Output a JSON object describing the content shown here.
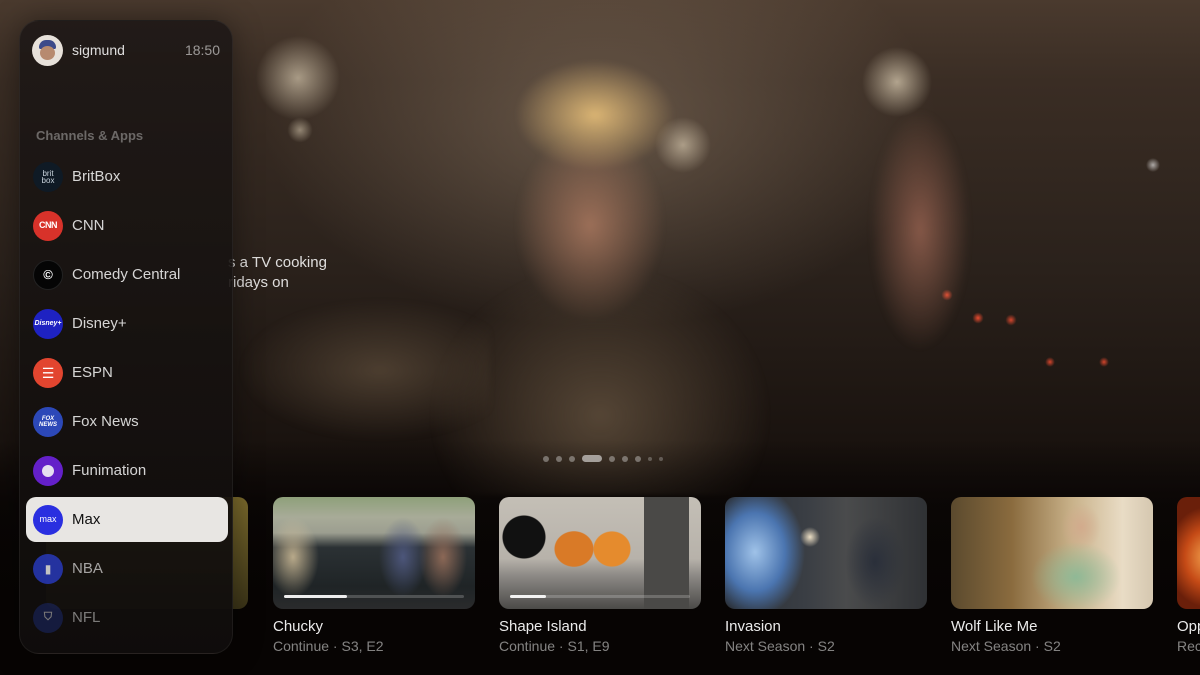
{
  "user": {
    "name": "sigmund",
    "time": "18:50"
  },
  "sidebar": {
    "section_label": "Channels & Apps",
    "items": [
      {
        "label": "BritBox",
        "icon": "britbox-logo-icon",
        "glyph": "brit box",
        "selected": false
      },
      {
        "label": "CNN",
        "icon": "cnn-logo-icon",
        "glyph": "CNN",
        "selected": false
      },
      {
        "label": "Comedy Central",
        "icon": "comedy-central-logo-icon",
        "glyph": "©",
        "selected": false
      },
      {
        "label": "Disney+",
        "icon": "disney-plus-logo-icon",
        "glyph": "Disney+",
        "selected": false
      },
      {
        "label": "ESPN",
        "icon": "espn-logo-icon",
        "glyph": "☰",
        "selected": false
      },
      {
        "label": "Fox News",
        "icon": "fox-news-logo-icon",
        "glyph": "FOX NEWS",
        "selected": false
      },
      {
        "label": "Funimation",
        "icon": "funimation-logo-icon",
        "glyph": "",
        "selected": false
      },
      {
        "label": "Max",
        "icon": "max-logo-icon",
        "glyph": "max",
        "selected": true
      },
      {
        "label": "NBA",
        "icon": "nba-logo-icon",
        "glyph": "▮",
        "selected": false
      },
      {
        "label": "NFL",
        "icon": "nfl-logo-icon",
        "glyph": "⛉",
        "selected": false
      }
    ]
  },
  "hero": {
    "description_lines": [
      "s a TV cooking",
      "ridays on"
    ],
    "page_count": 9,
    "active_page_index": 3
  },
  "up_next": [
    {
      "title": "Chucky",
      "subtitle": "Continue · S3, E2",
      "progress": 0.35
    },
    {
      "title": "Shape Island",
      "subtitle": "Continue · S1, E9",
      "progress": 0.2
    },
    {
      "title": "Invasion",
      "subtitle": "Next Season · S2",
      "progress": null
    },
    {
      "title": "Wolf Like Me",
      "subtitle": "Next Season · S2",
      "progress": null
    },
    {
      "title": "Opp",
      "subtitle": "Rec",
      "progress": null
    }
  ]
}
